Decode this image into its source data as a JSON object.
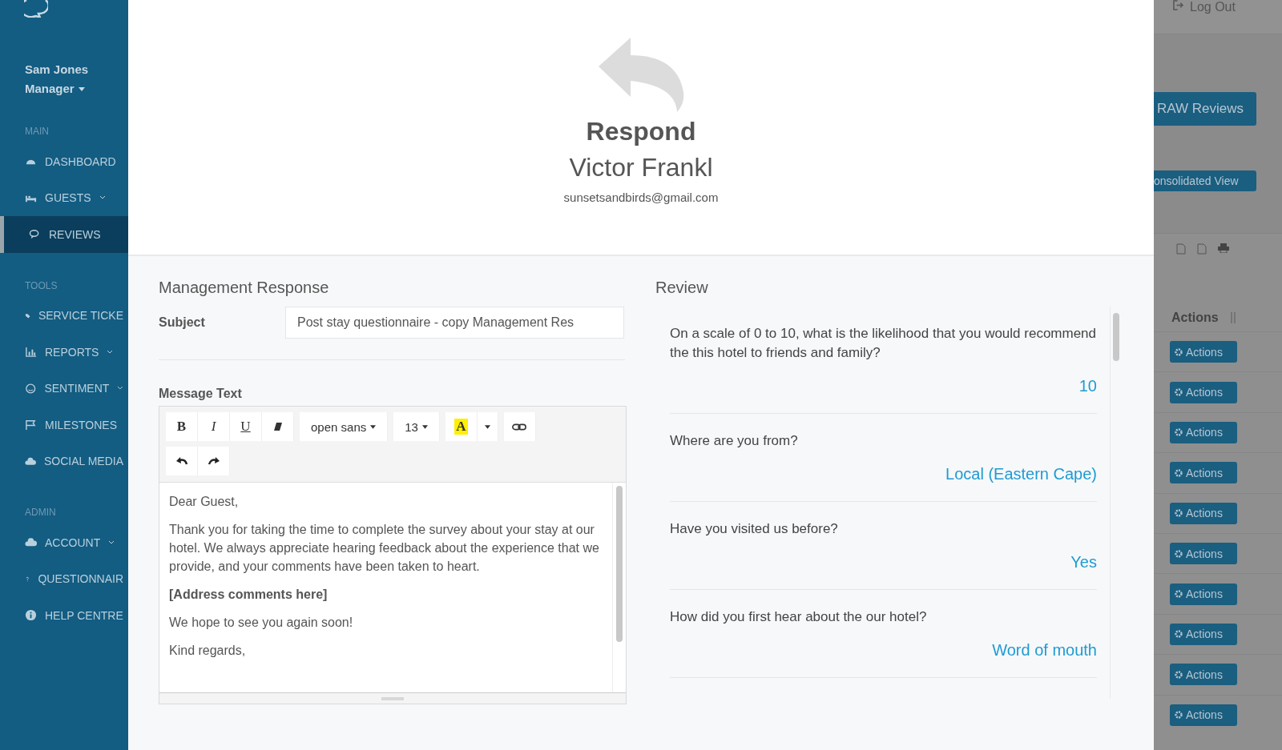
{
  "user": {
    "name": "Sam Jones",
    "role": "Manager"
  },
  "sidebar": {
    "sections": [
      {
        "title": "MAIN",
        "items": [
          {
            "label": "DASHBOARD",
            "submenu": false,
            "selected": false
          },
          {
            "label": "GUESTS",
            "submenu": true,
            "selected": false
          },
          {
            "label": "REVIEWS",
            "submenu": false,
            "selected": true
          }
        ]
      },
      {
        "title": "TOOLS",
        "items": [
          {
            "label": "SERVICE TICKE",
            "submenu": false,
            "selected": false
          },
          {
            "label": "REPORTS",
            "submenu": true,
            "selected": false
          },
          {
            "label": "SENTIMENT",
            "submenu": true,
            "selected": false
          },
          {
            "label": "MILESTONES",
            "submenu": false,
            "selected": false
          },
          {
            "label": "SOCIAL MEDIA",
            "submenu": false,
            "selected": false
          }
        ]
      },
      {
        "title": "ADMIN",
        "items": [
          {
            "label": "ACCOUNT",
            "submenu": true,
            "selected": false
          },
          {
            "label": "QUESTIONNAIR",
            "submenu": false,
            "selected": false
          },
          {
            "label": "HELP CENTRE",
            "submenu": false,
            "selected": false
          }
        ]
      }
    ]
  },
  "background": {
    "logout": "Log Out",
    "raw_button": "RAW Reviews",
    "consolidated_button": "onsolidated View",
    "actions_header": "Actions",
    "actions_buttons": [
      "Actions",
      "Actions",
      "Actions",
      "Actions",
      "Actions",
      "Actions",
      "Actions",
      "Actions",
      "Actions",
      "Actions"
    ]
  },
  "modal": {
    "title": "Respond",
    "guest_name": "Victor Frankl",
    "guest_email": "sunsetsandbirds@gmail.com",
    "response": {
      "heading": "Management Response",
      "subject_label": "Subject",
      "subject_value": "Post stay questionnaire - copy Management Res",
      "message_label": "Message Text",
      "toolbar": [
        [
          {
            "kind": "bold",
            "label": "B"
          },
          {
            "kind": "italic",
            "label": "I"
          },
          {
            "kind": "underline",
            "label": "U"
          },
          {
            "kind": "eraser"
          },
          {
            "kind": "dropdown",
            "label": "open sans"
          },
          {
            "kind": "dropdown",
            "label": "13"
          },
          {
            "kind": "color",
            "label": "A"
          },
          {
            "kind": "caret"
          },
          {
            "kind": "link"
          }
        ],
        [
          {
            "kind": "undo"
          },
          {
            "kind": "redo"
          }
        ]
      ],
      "paragraphs": [
        {
          "text": "Dear Guest,",
          "bold": false
        },
        {
          "text": "Thank you for taking the time to complete the survey about your stay at our hotel. We always appreciate hearing feedback about the experience that we provide, and your comments have been taken to heart.",
          "bold": false
        },
        {
          "text": "[Address comments here]",
          "bold": true
        },
        {
          "text": "We hope to see you again soon!",
          "bold": false
        },
        {
          "text": "Kind regards,",
          "bold": false
        }
      ]
    },
    "review": {
      "heading": "Review",
      "questions": [
        {
          "question": "On a scale of 0 to 10, what is the likelihood that you would recommend the this hotel to friends and family?",
          "answer": "10"
        },
        {
          "question": "Where are you from?",
          "answer": "Local (Eastern Cape)"
        },
        {
          "question": "Have you visited us before?",
          "answer": "Yes"
        },
        {
          "question": "How did you first hear about the our hotel?",
          "answer": "Word of mouth"
        }
      ]
    }
  }
}
